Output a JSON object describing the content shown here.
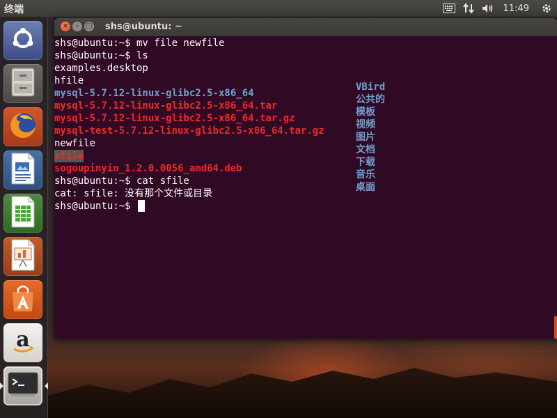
{
  "top_panel": {
    "app_name": "终端",
    "clock": "11:49",
    "icons": [
      "keyboard-icon",
      "network-arrows-icon",
      "volume-icon",
      "power-gear-icon"
    ]
  },
  "launcher": {
    "items": [
      {
        "name": "dash-home",
        "icon": "ubuntu-logo-icon"
      },
      {
        "name": "files",
        "icon": "file-cabinet-icon"
      },
      {
        "name": "firefox",
        "icon": "firefox-icon"
      },
      {
        "name": "libreoffice-writer",
        "icon": "writer-document-icon"
      },
      {
        "name": "libreoffice-calc",
        "icon": "calc-spreadsheet-icon"
      },
      {
        "name": "libreoffice-impress",
        "icon": "impress-presentation-icon"
      },
      {
        "name": "software-center",
        "icon": "shopping-bag-icon"
      },
      {
        "name": "amazon",
        "icon": "amazon-icon"
      },
      {
        "name": "terminal",
        "icon": "terminal-icon",
        "active": true
      }
    ]
  },
  "window": {
    "title": "shs@ubuntu: ~",
    "close_glyph": "×",
    "min_glyph": "–",
    "max_glyph": "□"
  },
  "terminal": {
    "prompt": "shs@ubuntu:~$",
    "lines": [
      {
        "text": "shs@ubuntu:~$ mv file newfile",
        "style": "normal"
      },
      {
        "text": "shs@ubuntu:~$ ls",
        "style": "normal"
      },
      {
        "text": "examples.desktop",
        "style": "normal"
      },
      {
        "text": "hfile",
        "style": "normal"
      },
      {
        "text": "mysql-5.7.12-linux-glibc2.5-x86_64",
        "style": "directory"
      },
      {
        "text": "mysql-5.7.12-linux-glibc2.5-x86_64.tar",
        "style": "archive"
      },
      {
        "text": "mysql-5.7.12-linux-glibc2.5-x86_64.tar.gz",
        "style": "archive"
      },
      {
        "text": "mysql-test-5.7.12-linux-glibc2.5-x86_64.tar.gz",
        "style": "archive"
      },
      {
        "text": "newfile",
        "style": "normal"
      },
      {
        "text": "sfile",
        "style": "broken-link"
      },
      {
        "text": "sogoupinyin_1.2.0.0056_amd64.deb",
        "style": "archive"
      },
      {
        "text": "shs@ubuntu:~$ cat sfile",
        "style": "normal"
      },
      {
        "text": "cat: sfile: 没有那个文件或目录",
        "style": "normal"
      },
      {
        "text": "shs@ubuntu:~$ ",
        "style": "normal"
      }
    ],
    "second_column": [
      "VBird",
      "公共的",
      "模板",
      "视频",
      "图片",
      "文档",
      "下载",
      "音乐",
      "桌面"
    ]
  },
  "colors": {
    "terminal_bg": "#300a24",
    "directory": "#729fcf",
    "archive": "#ef2929",
    "text": "#ffffff"
  }
}
